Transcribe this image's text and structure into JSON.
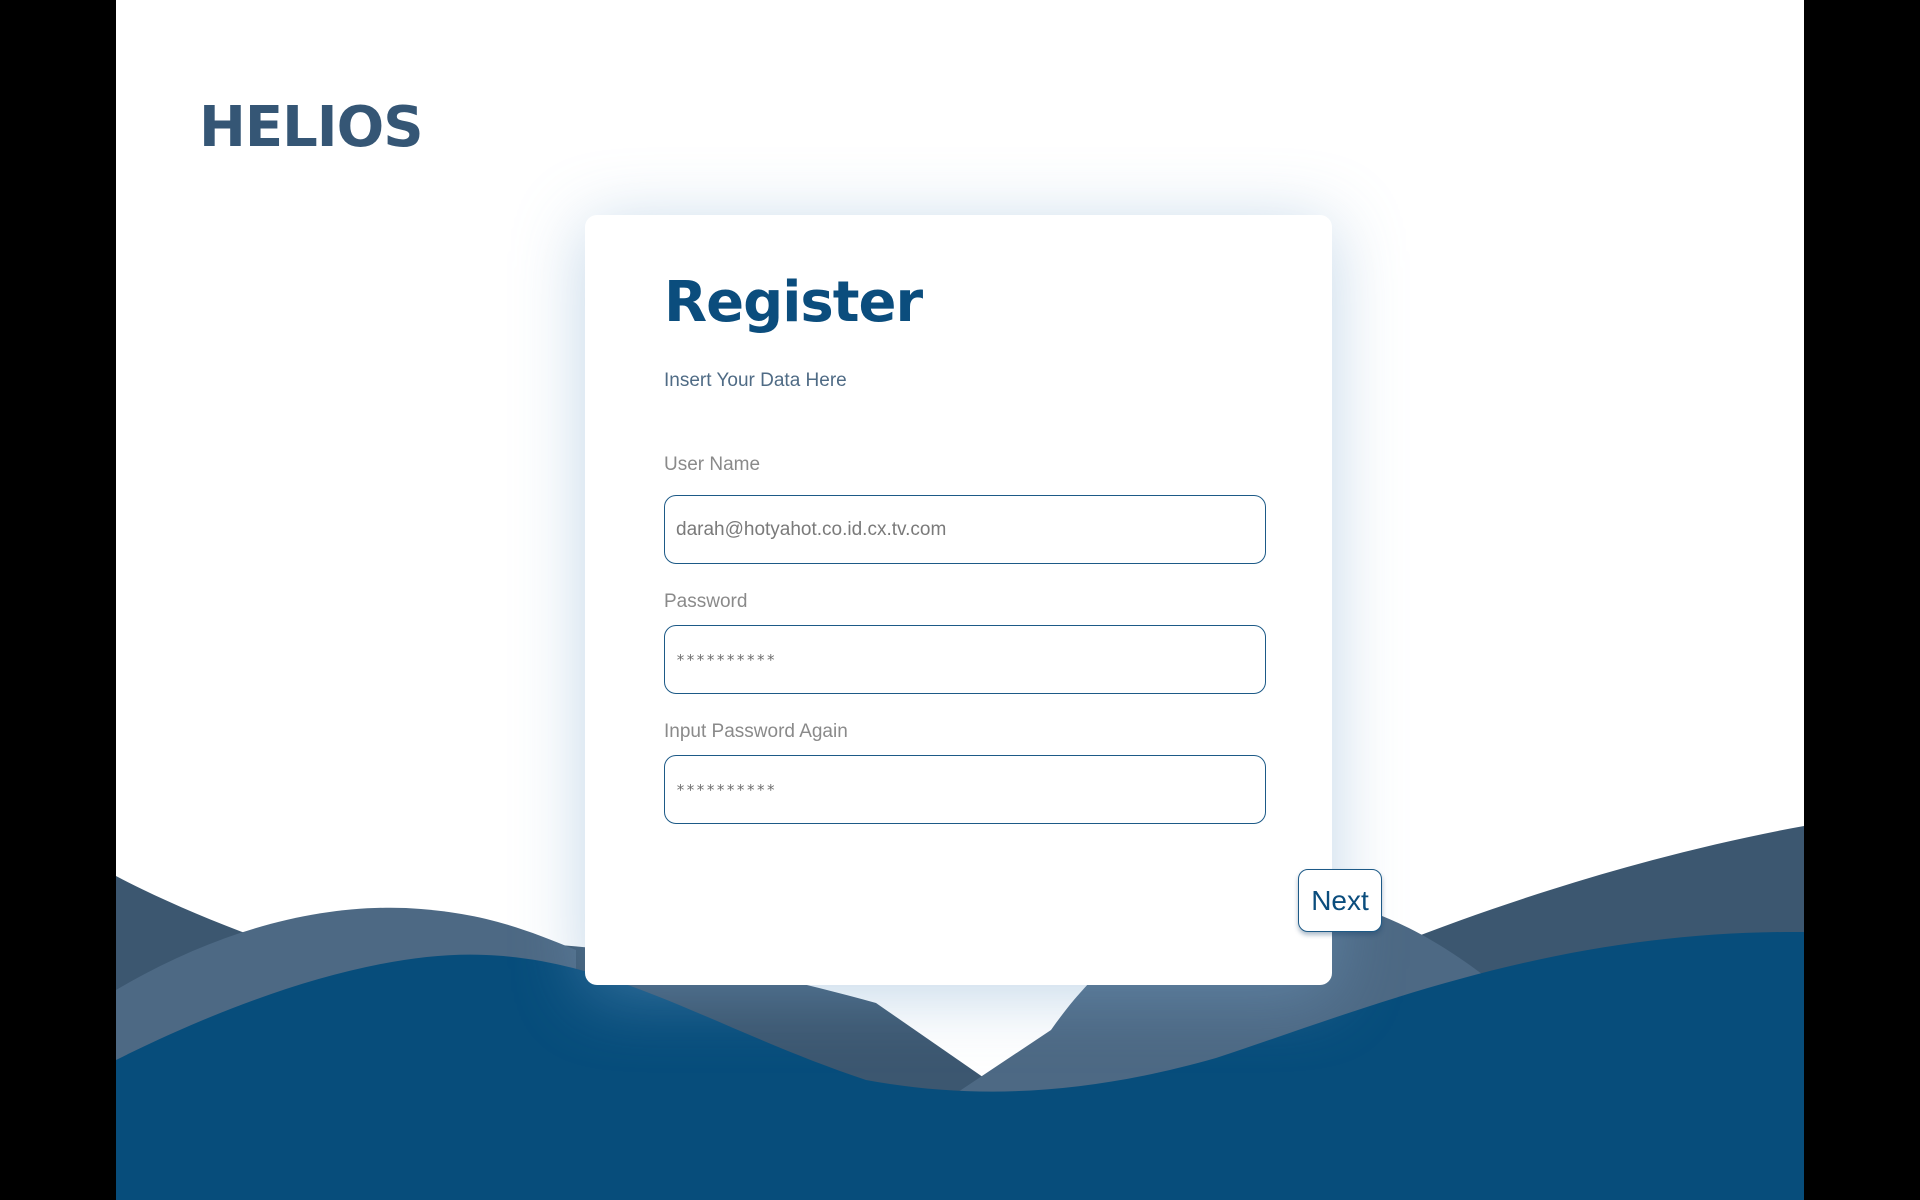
{
  "app": {
    "logo": "HELIOS"
  },
  "form": {
    "title": "Register",
    "subtitle": "Insert Your Data Here",
    "fields": [
      {
        "label": "User Name",
        "value": "darah@hotyahot.co.id.cx.tv.com"
      },
      {
        "label": "Password",
        "value": "**********"
      },
      {
        "label": "Input Password Again",
        "value": "**********"
      }
    ],
    "next_label": "Next"
  },
  "colors": {
    "brand_dark": "#355675",
    "brand_primary": "#0b4d7d",
    "wave_back": "#3c5770",
    "wave_mid": "#4d6984",
    "wave_front": "#074d7b"
  }
}
